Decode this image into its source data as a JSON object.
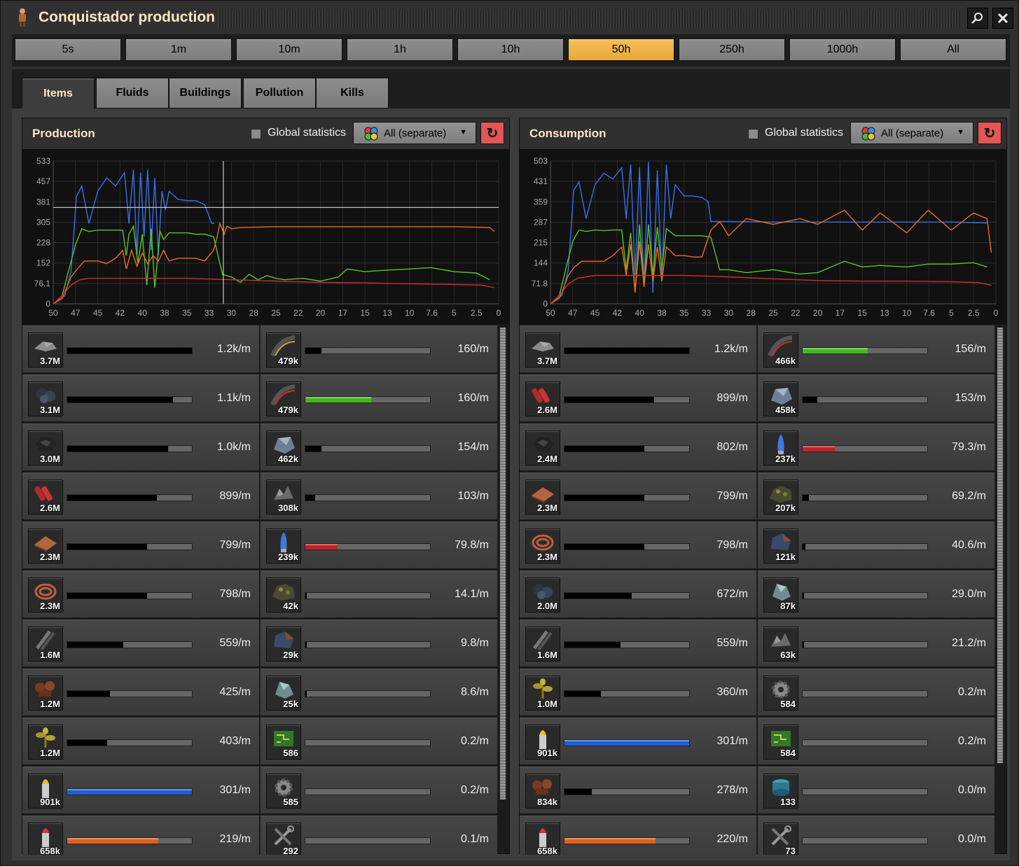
{
  "window": {
    "title": "Conquistador production",
    "search_icon": "magnifier-icon",
    "close_icon": "close-icon"
  },
  "time_buttons": [
    "5s",
    "1m",
    "10m",
    "1h",
    "10h",
    "50h",
    "250h",
    "1000h",
    "All"
  ],
  "active_time": "50h",
  "tabs": [
    "Items",
    "Fluids",
    "Buildings",
    "Pollution",
    "Kills"
  ],
  "active_tab": "Items",
  "production": {
    "title": "Production",
    "global_label": "Global statistics",
    "filter_label": "All (separate)",
    "chart_data": {
      "type": "line",
      "xlabel": "",
      "ylabel": "",
      "x_ticks": [
        "50",
        "47",
        "45",
        "42",
        "40",
        "38",
        "35",
        "33",
        "30",
        "28",
        "25",
        "22",
        "20",
        "17",
        "15",
        "13",
        "10",
        "7.6",
        "5",
        "2.5",
        "0"
      ],
      "y_ticks": [
        "0",
        "76.1",
        "152",
        "228",
        "305",
        "381",
        "457",
        "533"
      ],
      "ylim": [
        0,
        533
      ],
      "xlim": [
        50,
        0
      ],
      "series": [
        {
          "color": "#3a6fe8",
          "x": [
            50,
            48.7,
            48,
            47.4,
            46.8,
            46,
            45,
            44,
            43,
            42,
            41.5,
            41,
            40.6,
            40.2,
            39.8,
            39.4,
            39,
            38.6,
            38.2,
            37.8,
            37.4,
            37,
            36,
            35,
            34,
            33,
            32.2,
            31.9
          ],
          "values": [
            0,
            30,
            120,
            400,
            440,
            300,
            420,
            470,
            440,
            490,
            300,
            500,
            180,
            490,
            250,
            500,
            200,
            470,
            180,
            420,
            350,
            420,
            390,
            385,
            385,
            370,
            300,
            300
          ]
        },
        {
          "color": "#56c42a",
          "x": [
            50,
            49,
            48.3,
            47.5,
            46.8,
            46,
            45,
            44,
            43,
            42.2,
            41.8,
            41.5,
            41,
            40.5,
            40,
            39.5,
            39,
            38.6,
            38,
            37.6,
            37,
            36,
            35,
            34,
            33,
            32,
            31,
            30,
            29,
            28,
            27,
            26,
            25,
            24,
            22,
            20,
            18,
            17,
            15,
            13,
            10,
            7.6,
            5,
            2.5,
            1
          ],
          "values": [
            0,
            30,
            120,
            220,
            280,
            270,
            275,
            275,
            275,
            275,
            180,
            260,
            290,
            150,
            260,
            70,
            280,
            60,
            270,
            240,
            265,
            265,
            265,
            260,
            260,
            250,
            110,
            100,
            80,
            110,
            90,
            105,
            95,
            90,
            95,
            85,
            100,
            130,
            120,
            125,
            130,
            135,
            120,
            115,
            90
          ]
        },
        {
          "color": "#ee6a1f",
          "x": [
            50,
            49,
            48.5,
            48,
            47.3,
            46.5,
            45,
            44,
            43,
            42.2,
            41.8,
            41.2,
            40.6,
            40,
            39.4,
            38.8,
            38.2,
            37.6,
            37,
            36,
            35,
            34,
            33,
            32,
            31.6,
            31.3,
            30.8,
            30.5,
            30,
            29,
            25,
            20,
            15,
            10,
            5,
            1,
            0.5
          ],
          "values": [
            0,
            20,
            60,
            100,
            130,
            160,
            160,
            150,
            170,
            200,
            130,
            200,
            140,
            190,
            150,
            180,
            160,
            200,
            160,
            170,
            170,
            170,
            160,
            200,
            250,
            300,
            260,
            290,
            280,
            285,
            288,
            288,
            288,
            288,
            288,
            285,
            270
          ]
        },
        {
          "color": "#d32e2e",
          "x": [
            50,
            49,
            48,
            47,
            46,
            45,
            40,
            35,
            30,
            25,
            20,
            15,
            10,
            5,
            2,
            0.5
          ],
          "values": [
            0,
            30,
            70,
            90,
            95,
            95,
            95,
            95,
            90,
            85,
            80,
            78,
            75,
            72,
            70,
            60
          ]
        }
      ]
    },
    "items": [
      {
        "icon": "stone-icon",
        "count": "3.7M",
        "rate": "1.2k/m",
        "fill": 1.0,
        "color": "#000000"
      },
      {
        "icon": "rail-icon",
        "count": "479k",
        "rate": "160/m",
        "fill": 0.13,
        "color": "#000000"
      },
      {
        "icon": "coal-icon",
        "count": "3.1M",
        "rate": "1.1k/m",
        "fill": 0.85,
        "color": "#000000"
      },
      {
        "icon": "rail-curved-icon",
        "count": "479k",
        "rate": "160/m",
        "fill": 0.53,
        "color": "#3fb81e"
      },
      {
        "icon": "raw-coal-icon",
        "count": "3.0M",
        "rate": "1.0k/m",
        "fill": 0.81,
        "color": "#000000"
      },
      {
        "icon": "iron-ore-icon",
        "count": "462k",
        "rate": "154/m",
        "fill": 0.13,
        "color": "#000000"
      },
      {
        "icon": "explosives-icon",
        "count": "2.6M",
        "rate": "899/m",
        "fill": 0.72,
        "color": "#000000"
      },
      {
        "icon": "scrap-icon",
        "count": "308k",
        "rate": "103/m",
        "fill": 0.08,
        "color": "#000000"
      },
      {
        "icon": "copper-plate-icon",
        "count": "2.3M",
        "rate": "799/m",
        "fill": 0.64,
        "color": "#000000"
      },
      {
        "icon": "shell-icon",
        "count": "239k",
        "rate": "79.8/m",
        "fill": 0.26,
        "color": "#c4202a"
      },
      {
        "icon": "copper-cable-icon",
        "count": "2.3M",
        "rate": "798/m",
        "fill": 0.64,
        "color": "#000000"
      },
      {
        "icon": "sulfur-rock-icon",
        "count": "42k",
        "rate": "14.1/m",
        "fill": 0.01,
        "color": "#000000"
      },
      {
        "icon": "steel-rod-icon",
        "count": "1.6M",
        "rate": "559/m",
        "fill": 0.45,
        "color": "#000000"
      },
      {
        "icon": "iron-chunk-icon",
        "count": "29k",
        "rate": "9.8/m",
        "fill": 0.01,
        "color": "#000000"
      },
      {
        "icon": "bones-icon",
        "count": "1.2M",
        "rate": "425/m",
        "fill": 0.34,
        "color": "#000000"
      },
      {
        "icon": "crystal-icon",
        "count": "25k",
        "rate": "8.6/m",
        "fill": 0.01,
        "color": "#000000"
      },
      {
        "icon": "plant-icon",
        "count": "1.2M",
        "rate": "403/m",
        "fill": 0.32,
        "color": "#000000"
      },
      {
        "icon": "circuit-icon",
        "count": "586",
        "rate": "0.2/m",
        "fill": 0.0,
        "color": "#000000"
      },
      {
        "icon": "bullet-icon",
        "count": "901k",
        "rate": "301/m",
        "fill": 1.0,
        "color": "#1f5fd6"
      },
      {
        "icon": "gear-icon",
        "count": "585",
        "rate": "0.2/m",
        "fill": 0.0,
        "color": "#000000"
      },
      {
        "icon": "cartridge-icon",
        "count": "658k",
        "rate": "219/m",
        "fill": 0.73,
        "color": "#e3601a"
      },
      {
        "icon": "repair-tools-icon",
        "count": "292",
        "rate": "0.1/m",
        "fill": 0.0,
        "color": "#000000"
      }
    ]
  },
  "consumption": {
    "title": "Consumption",
    "global_label": "Global statistics",
    "filter_label": "All (separate)",
    "chart_data": {
      "type": "line",
      "xlabel": "",
      "ylabel": "",
      "x_ticks": [
        "50",
        "47",
        "45",
        "42",
        "40",
        "38",
        "35",
        "33",
        "30",
        "28",
        "25",
        "22",
        "20",
        "17",
        "15",
        "13",
        "10",
        "7.6",
        "5",
        "2.5",
        "0"
      ],
      "y_ticks": [
        "0",
        "71.8",
        "144",
        "215",
        "287",
        "359",
        "431",
        "503"
      ],
      "ylim": [
        0,
        503
      ],
      "xlim": [
        50,
        0
      ],
      "series": [
        {
          "color": "#3a6fe8",
          "x": [
            50,
            48.7,
            48,
            47.4,
            46.8,
            46,
            45,
            44,
            43,
            42,
            41.5,
            41,
            40.5,
            40,
            39.5,
            39,
            38.5,
            38,
            37.5,
            37,
            36.5,
            36,
            35,
            34,
            33,
            32.3,
            32,
            30,
            25,
            20,
            15,
            10,
            5,
            1
          ],
          "values": [
            0,
            30,
            120,
            400,
            430,
            300,
            420,
            460,
            440,
            480,
            300,
            490,
            100,
            480,
            60,
            500,
            40,
            470,
            80,
            490,
            300,
            420,
            380,
            380,
            375,
            360,
            290,
            290,
            288,
            288,
            288,
            288,
            288,
            285
          ]
        },
        {
          "color": "#56c42a",
          "x": [
            50,
            49,
            48.3,
            47.5,
            46.8,
            46,
            45,
            44,
            43,
            42,
            41.5,
            41,
            40.5,
            40,
            39.5,
            39,
            38.5,
            38,
            37.5,
            37,
            36,
            35,
            34,
            33,
            32,
            31,
            30,
            28,
            25,
            22,
            20,
            17,
            15,
            13,
            10,
            7.6,
            5,
            2.5,
            1
          ],
          "values": [
            0,
            30,
            120,
            220,
            260,
            255,
            260,
            258,
            260,
            260,
            120,
            250,
            40,
            280,
            60,
            280,
            100,
            270,
            120,
            265,
            240,
            240,
            240,
            240,
            235,
            120,
            120,
            110,
            120,
            105,
            110,
            150,
            130,
            135,
            130,
            140,
            140,
            145,
            130
          ]
        },
        {
          "color": "#ee6a1f",
          "x": [
            50,
            49,
            48.5,
            48,
            47.3,
            46.5,
            45,
            44,
            43,
            42,
            41.5,
            41,
            40.5,
            40,
            39.5,
            39,
            38.5,
            38,
            37.5,
            37,
            36,
            35,
            34,
            33,
            32,
            31,
            30,
            28,
            25,
            22,
            20,
            17,
            15,
            13,
            10,
            7.6,
            5,
            2.5,
            1,
            0.5
          ],
          "values": [
            0,
            20,
            60,
            100,
            130,
            150,
            150,
            150,
            170,
            200,
            100,
            210,
            40,
            220,
            60,
            210,
            80,
            200,
            80,
            200,
            170,
            170,
            165,
            165,
            260,
            290,
            240,
            300,
            280,
            300,
            280,
            330,
            260,
            320,
            250,
            330,
            260,
            320,
            300,
            180
          ]
        },
        {
          "color": "#d32e2e",
          "x": [
            50,
            49,
            48,
            47,
            46,
            45,
            40,
            35,
            30,
            25,
            20,
            15,
            10,
            5,
            2,
            0.5
          ],
          "values": [
            0,
            30,
            70,
            90,
            95,
            100,
            100,
            100,
            95,
            88,
            82,
            80,
            80,
            78,
            75,
            65
          ]
        }
      ]
    },
    "items": [
      {
        "icon": "stone-icon",
        "count": "3.7M",
        "rate": "1.2k/m",
        "fill": 1.0,
        "color": "#000000"
      },
      {
        "icon": "rail-curved-icon",
        "count": "466k",
        "rate": "156/m",
        "fill": 0.52,
        "color": "#3fb81e"
      },
      {
        "icon": "explosives-icon",
        "count": "2.6M",
        "rate": "899/m",
        "fill": 0.72,
        "color": "#000000"
      },
      {
        "icon": "iron-ore-icon",
        "count": "458k",
        "rate": "153/m",
        "fill": 0.12,
        "color": "#000000"
      },
      {
        "icon": "raw-coal-icon",
        "count": "2.4M",
        "rate": "802/m",
        "fill": 0.64,
        "color": "#000000"
      },
      {
        "icon": "shell-icon",
        "count": "237k",
        "rate": "79.3/m",
        "fill": 0.26,
        "color": "#c4202a"
      },
      {
        "icon": "copper-plate-icon",
        "count": "2.3M",
        "rate": "799/m",
        "fill": 0.64,
        "color": "#000000"
      },
      {
        "icon": "sulfur-rock-icon",
        "count": "207k",
        "rate": "69.2/m",
        "fill": 0.05,
        "color": "#000000"
      },
      {
        "icon": "copper-cable-icon",
        "count": "2.3M",
        "rate": "798/m",
        "fill": 0.64,
        "color": "#000000"
      },
      {
        "icon": "iron-chunk-icon",
        "count": "121k",
        "rate": "40.6/m",
        "fill": 0.02,
        "color": "#000000"
      },
      {
        "icon": "coal-icon",
        "count": "2.0M",
        "rate": "672/m",
        "fill": 0.54,
        "color": "#000000"
      },
      {
        "icon": "crystal-icon",
        "count": "87k",
        "rate": "29.0/m",
        "fill": 0.01,
        "color": "#000000"
      },
      {
        "icon": "steel-rod-icon",
        "count": "1.6M",
        "rate": "559/m",
        "fill": 0.45,
        "color": "#000000"
      },
      {
        "icon": "scrap-icon",
        "count": "63k",
        "rate": "21.2/m",
        "fill": 0.01,
        "color": "#000000"
      },
      {
        "icon": "plant-icon",
        "count": "1.0M",
        "rate": "360/m",
        "fill": 0.29,
        "color": "#000000"
      },
      {
        "icon": "gear-icon",
        "count": "584",
        "rate": "0.2/m",
        "fill": 0.0,
        "color": "#000000"
      },
      {
        "icon": "bullet-icon",
        "count": "901k",
        "rate": "301/m",
        "fill": 1.0,
        "color": "#1f5fd6"
      },
      {
        "icon": "circuit-icon",
        "count": "584",
        "rate": "0.2/m",
        "fill": 0.0,
        "color": "#000000"
      },
      {
        "icon": "bones-icon",
        "count": "834k",
        "rate": "278/m",
        "fill": 0.22,
        "color": "#000000"
      },
      {
        "icon": "water-barrel-icon",
        "count": "133",
        "rate": "0.0/m",
        "fill": 0.0,
        "color": "#000000"
      },
      {
        "icon": "cartridge-icon",
        "count": "658k",
        "rate": "220/m",
        "fill": 0.73,
        "color": "#e3601a"
      },
      {
        "icon": "repair-tools-icon",
        "count": "73",
        "rate": "0.0/m",
        "fill": 0.0,
        "color": "#000000"
      }
    ]
  }
}
